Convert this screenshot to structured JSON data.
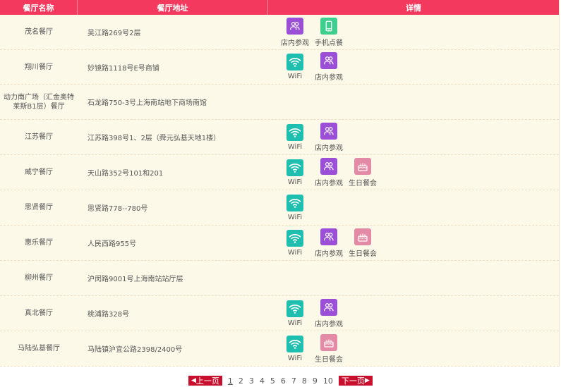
{
  "header": {
    "col_name": "餐厅名称",
    "col_address": "餐厅地址",
    "col_details": "详情"
  },
  "colors": {
    "header_bg": "#f33a5e",
    "row_bg": "#fdf9e9",
    "wifi": "#1fbfb0",
    "tour": "#9b4fd6",
    "mobile": "#3ecf8e",
    "birthday": "#e38aa6",
    "pager_btn": "#c8102e"
  },
  "feature_labels": {
    "wifi": "WiFi",
    "tour": "店内参观",
    "mobile": "手机点餐",
    "birthday": "生日餐会"
  },
  "rows": [
    {
      "name": "茂名餐厅",
      "address": "吴江路269号2层",
      "features": [
        "tour",
        "mobile"
      ]
    },
    {
      "name": "翔川餐厅",
      "address": "妙镜路1118号E号商铺",
      "features": [
        "wifi",
        "tour"
      ]
    },
    {
      "name": "动力南广场（汇金奥特莱斯B1层）餐厅",
      "address": "石龙路750-3号上海南站地下商场南馆",
      "features": []
    },
    {
      "name": "江苏餐厅",
      "address": "江苏路398号1、2层（舜元弘基天地1楼）",
      "features": [
        "wifi",
        "tour"
      ]
    },
    {
      "name": "威宁餐厅",
      "address": "天山路352号101和201",
      "features": [
        "wifi",
        "tour",
        "birthday"
      ]
    },
    {
      "name": "思贤餐厅",
      "address": "思贤路778--780号",
      "features": [
        "wifi"
      ]
    },
    {
      "name": "惠乐餐厅",
      "address": "人民西路955号",
      "features": [
        "wifi",
        "tour",
        "birthday"
      ]
    },
    {
      "name": "柳州餐厅",
      "address": "沪闵路9001号上海南站站厅层",
      "features": []
    },
    {
      "name": "真北餐厅",
      "address": "桃浦路328号",
      "features": [
        "wifi",
        "tour"
      ]
    },
    {
      "name": "马陆弘基餐厅",
      "address": "马陆镇沪宜公路2398/2400号",
      "features": [
        "wifi",
        "birthday"
      ]
    }
  ],
  "pager": {
    "prev": "上一页",
    "next": "下一页",
    "pages": [
      "1",
      "2",
      "3",
      "4",
      "5",
      "6",
      "7",
      "8",
      "9",
      "10"
    ],
    "current": "1"
  }
}
